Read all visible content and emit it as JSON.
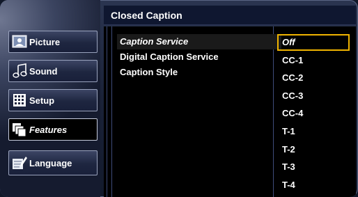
{
  "header": {
    "title": "Closed Caption"
  },
  "sidebar": {
    "items": [
      {
        "label": "Picture",
        "icon": "picture-icon",
        "active": false
      },
      {
        "label": "Sound",
        "icon": "music-note-icon",
        "active": false
      },
      {
        "label": "Setup",
        "icon": "grid-icon",
        "active": false
      },
      {
        "label": "Features",
        "icon": "features-icon",
        "active": true
      },
      {
        "label": "Language",
        "icon": "language-icon",
        "active": false
      }
    ]
  },
  "main": {
    "options": [
      "Caption Service",
      "Digital Caption Service",
      "Caption Style"
    ],
    "selected_option": "Caption Service",
    "values": [
      "Off",
      "CC-1",
      "CC-2",
      "CC-3",
      "CC-4",
      "T-1",
      "T-2",
      "T-3",
      "T-4"
    ],
    "selected_value": "Off"
  },
  "colors": {
    "highlight_border": "#f0b400",
    "panel_bg": "#000000",
    "header_bg": "#0f1730"
  }
}
